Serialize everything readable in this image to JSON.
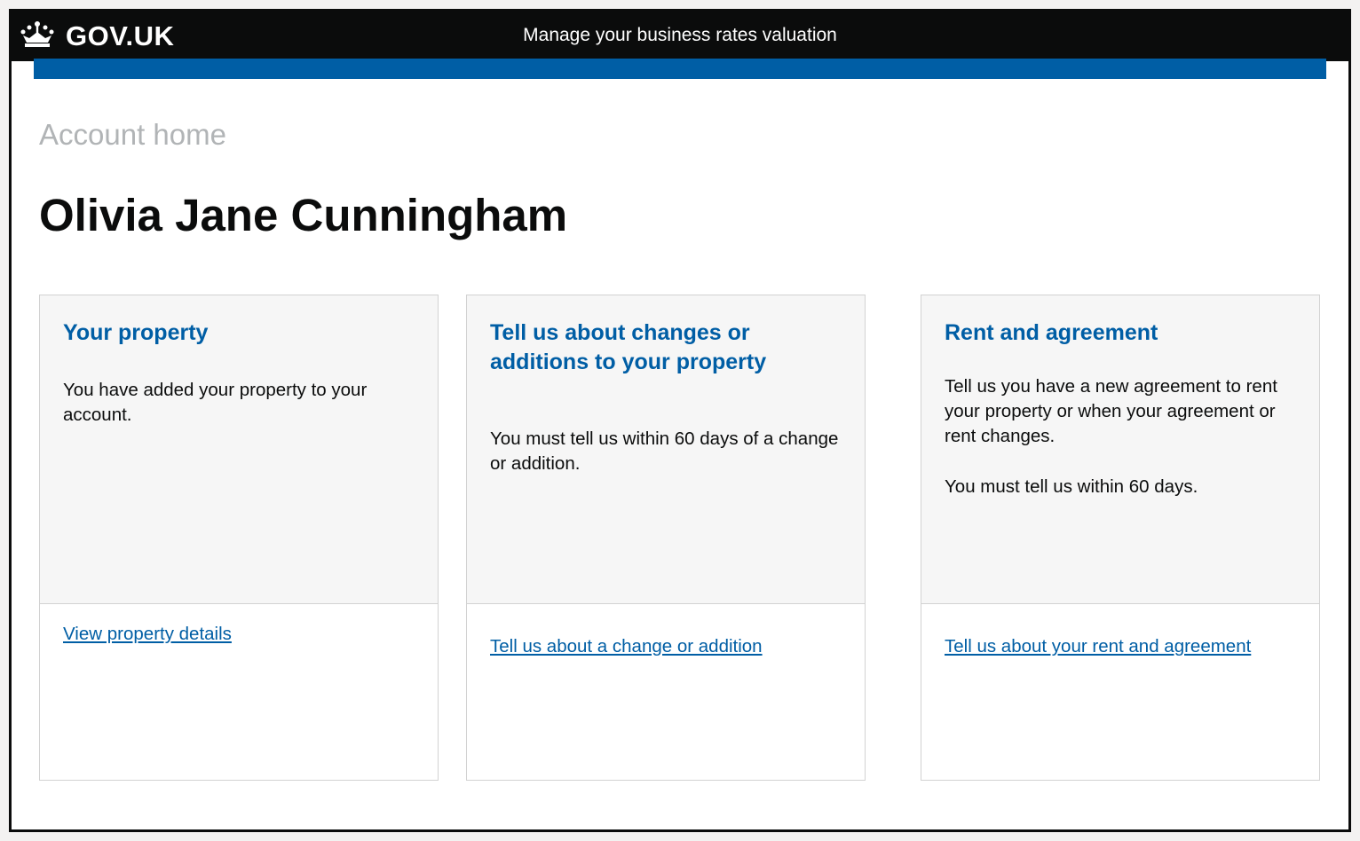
{
  "header": {
    "logo_text": "GOV.UK",
    "logo_icon": "crown-icon",
    "service_name": "Manage your business rates valuation"
  },
  "page": {
    "caption": "Account home",
    "title": "Olivia Jane Cunningham"
  },
  "cards": [
    {
      "heading": "Your property",
      "paragraphs": [
        "You have added your property to your account."
      ],
      "link": "View property details"
    },
    {
      "heading": "Tell us about changes or additions to your property",
      "paragraphs": [
        "You must tell us within 60 days of a change or addition."
      ],
      "link": "Tell us about a change or addition"
    },
    {
      "heading": "Rent and agreement",
      "paragraphs": [
        "Tell us you have a new agreement to rent your property or when your agreement or rent changes.",
        "You must tell us within 60 days."
      ],
      "link": "Tell us about your rent and agreement"
    }
  ],
  "colors": {
    "header_bg": "#0b0c0c",
    "brand_blue": "#005ea5",
    "caption_grey": "#b1b4b6",
    "card_bg": "#f6f6f6"
  }
}
